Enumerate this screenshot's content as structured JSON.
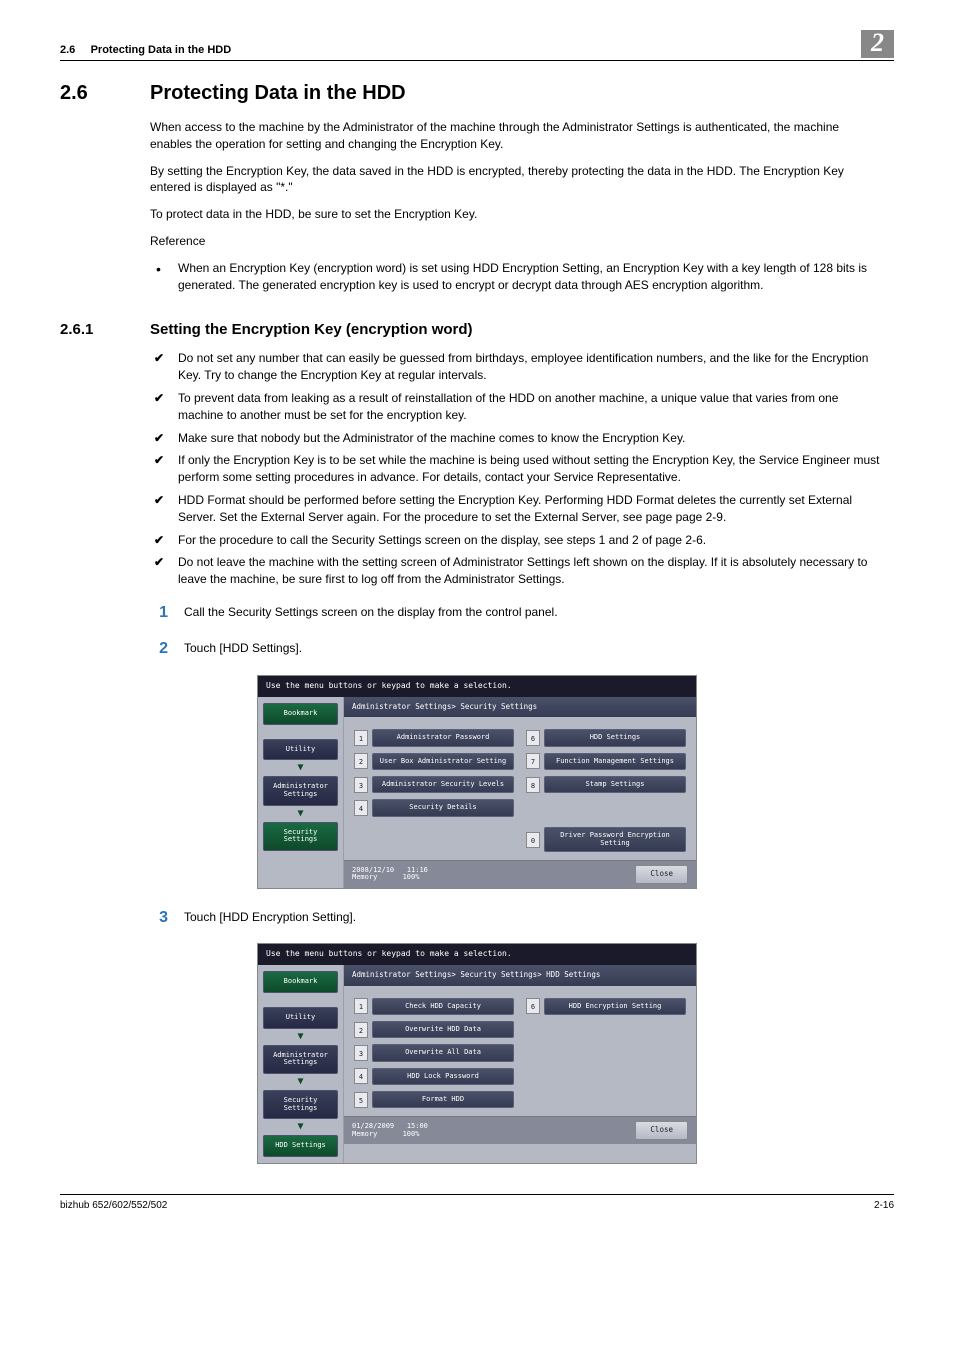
{
  "header": {
    "section_ref": "2.6",
    "section_label": "Protecting Data in the HDD",
    "chapter_badge": "2"
  },
  "section": {
    "num": "2.6",
    "title": "Protecting Data in the HDD",
    "p1": "When access to the machine by the Administrator of the machine through the Administrator Settings is authenticated, the machine enables the operation for setting and changing the Encryption Key.",
    "p2": "By setting the Encryption Key, the data saved in the HDD is encrypted, thereby protecting the data in the HDD. The Encryption Key entered is displayed as \"*.\"",
    "p3": "To protect data in the HDD, be sure to set the Encryption Key.",
    "ref_label": "Reference",
    "ref_item": "When an Encryption Key (encryption word) is set using HDD Encryption Setting, an Encryption Key with a key length of 128 bits is generated. The generated encryption key is used to encrypt or decrypt data through AES encryption algorithm."
  },
  "subsection": {
    "num": "2.6.1",
    "title": "Setting the Encryption Key (encryption word)",
    "checks": [
      "Do not set any number that can easily be guessed from birthdays, employee identification numbers, and the like for the Encryption Key. Try to change the Encryption Key at regular intervals.",
      "To prevent data from leaking as a result of reinstallation of the HDD on another machine, a unique value that varies from one machine to another must be set for the encryption key.",
      "Make sure that nobody but the Administrator of the machine comes to know the Encryption Key.",
      "If only the Encryption Key is to be set while the machine is being used without setting the Encryption Key, the Service Engineer must perform some setting procedures in advance. For details, contact your Service Representative.",
      "HDD Format should be performed before setting the Encryption Key. Performing HDD Format deletes the currently set External Server. Set the External Server again. For the procedure to set the External Server, see page page 2-9.",
      "For the procedure to call the Security Settings screen on the display, see steps 1 and 2 of page 2-6.",
      "Do not leave the machine with the setting screen of Administrator Settings left shown on the display. If it is absolutely necessary to leave the machine, be sure first to log off from the Administrator Settings."
    ],
    "steps": [
      {
        "n": "1",
        "t": "Call the Security Settings screen on the display from the control panel."
      },
      {
        "n": "2",
        "t": "Touch [HDD Settings]."
      },
      {
        "n": "3",
        "t": "Touch [HDD Encryption Setting]."
      }
    ]
  },
  "panel1": {
    "hint": "Use the menu buttons or keypad to make a selection.",
    "bookmark": "Bookmark",
    "side": [
      "Utility",
      "Administrator Settings",
      "Security Settings"
    ],
    "crumb": "Administrator Settings> Security Settings",
    "left": [
      {
        "n": "1",
        "l": "Administrator Password"
      },
      {
        "n": "2",
        "l": "User Box Administrator Setting"
      },
      {
        "n": "3",
        "l": "Administrator Security Levels"
      },
      {
        "n": "4",
        "l": "Security Details"
      }
    ],
    "right": [
      {
        "n": "6",
        "l": "HDD Settings"
      },
      {
        "n": "7",
        "l": "Function Management Settings"
      },
      {
        "n": "8",
        "l": "Stamp Settings"
      },
      {
        "n": "0",
        "l": "Driver Password Encryption Setting"
      }
    ],
    "date": "2008/12/10",
    "time": "11:16",
    "mem_label": "Memory",
    "mem": "100%",
    "close": "Close"
  },
  "panel2": {
    "hint": "Use the menu buttons or keypad to make a selection.",
    "bookmark": "Bookmark",
    "side": [
      "Utility",
      "Administrator Settings",
      "Security Settings",
      "HDD Settings"
    ],
    "crumb": "Administrator Settings> Security Settings> HDD Settings",
    "left": [
      {
        "n": "1",
        "l": "Check HDD Capacity"
      },
      {
        "n": "2",
        "l": "Overwrite HDD Data"
      },
      {
        "n": "3",
        "l": "Overwrite All Data"
      },
      {
        "n": "4",
        "l": "HDD Lock Password"
      },
      {
        "n": "5",
        "l": "Format HDD"
      }
    ],
    "right": [
      {
        "n": "6",
        "l": "HDD Encryption Setting"
      }
    ],
    "date": "01/28/2009",
    "time": "15:00",
    "mem_label": "Memory",
    "mem": "100%",
    "close": "Close"
  },
  "footer": {
    "model": "bizhub 652/602/552/502",
    "page": "2-16"
  }
}
